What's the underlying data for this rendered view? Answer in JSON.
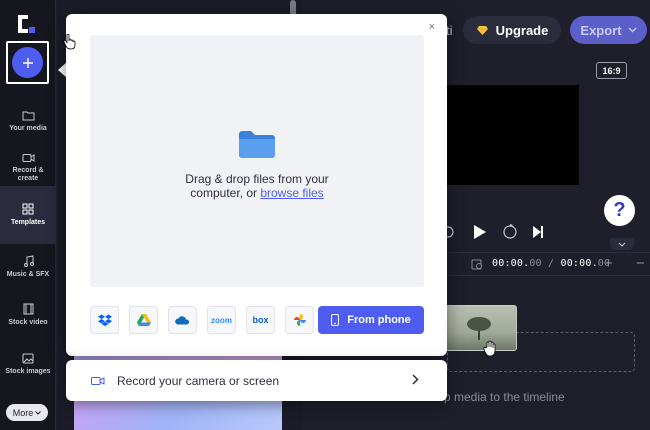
{
  "sidebar": {
    "items": [
      {
        "label": "Your media",
        "icon": "folder-icon"
      },
      {
        "label": "Record & create",
        "icon": "camera-icon"
      },
      {
        "label": "Templates",
        "icon": "templates-icon"
      },
      {
        "label": "Music & SFX",
        "icon": "music-note-icon"
      },
      {
        "label": "Stock video",
        "icon": "film-icon"
      },
      {
        "label": "Stock images",
        "icon": "image-icon"
      }
    ],
    "more_label": "More"
  },
  "header": {
    "tab_partial": "ti",
    "upgrade_label": "Upgrade",
    "export_label": "Export",
    "aspect_ratio": "16:9"
  },
  "help_symbol": "?",
  "timeline": {
    "current_time": "00:00.",
    "current_frac": "00",
    "total_time": "00:00.",
    "total_frac": "00",
    "drop_hint": "p media to the timeline"
  },
  "upload_dialog": {
    "close_symbol": "×",
    "drop_text_1": "Drag & drop files from your",
    "drop_text_2": "computer, or ",
    "browse_link": "browse files",
    "providers": [
      "dropbox",
      "google-drive",
      "onedrive",
      "zoom",
      "box",
      "google-photos"
    ],
    "zoom_label": "zoom",
    "box_label": "box",
    "from_phone_label": "From phone"
  },
  "record_bar": {
    "label": "Record your camera or screen"
  },
  "colors": {
    "accent": "#4e5cf0",
    "export": "#5b5fc7",
    "background": "#1e1f2b"
  }
}
